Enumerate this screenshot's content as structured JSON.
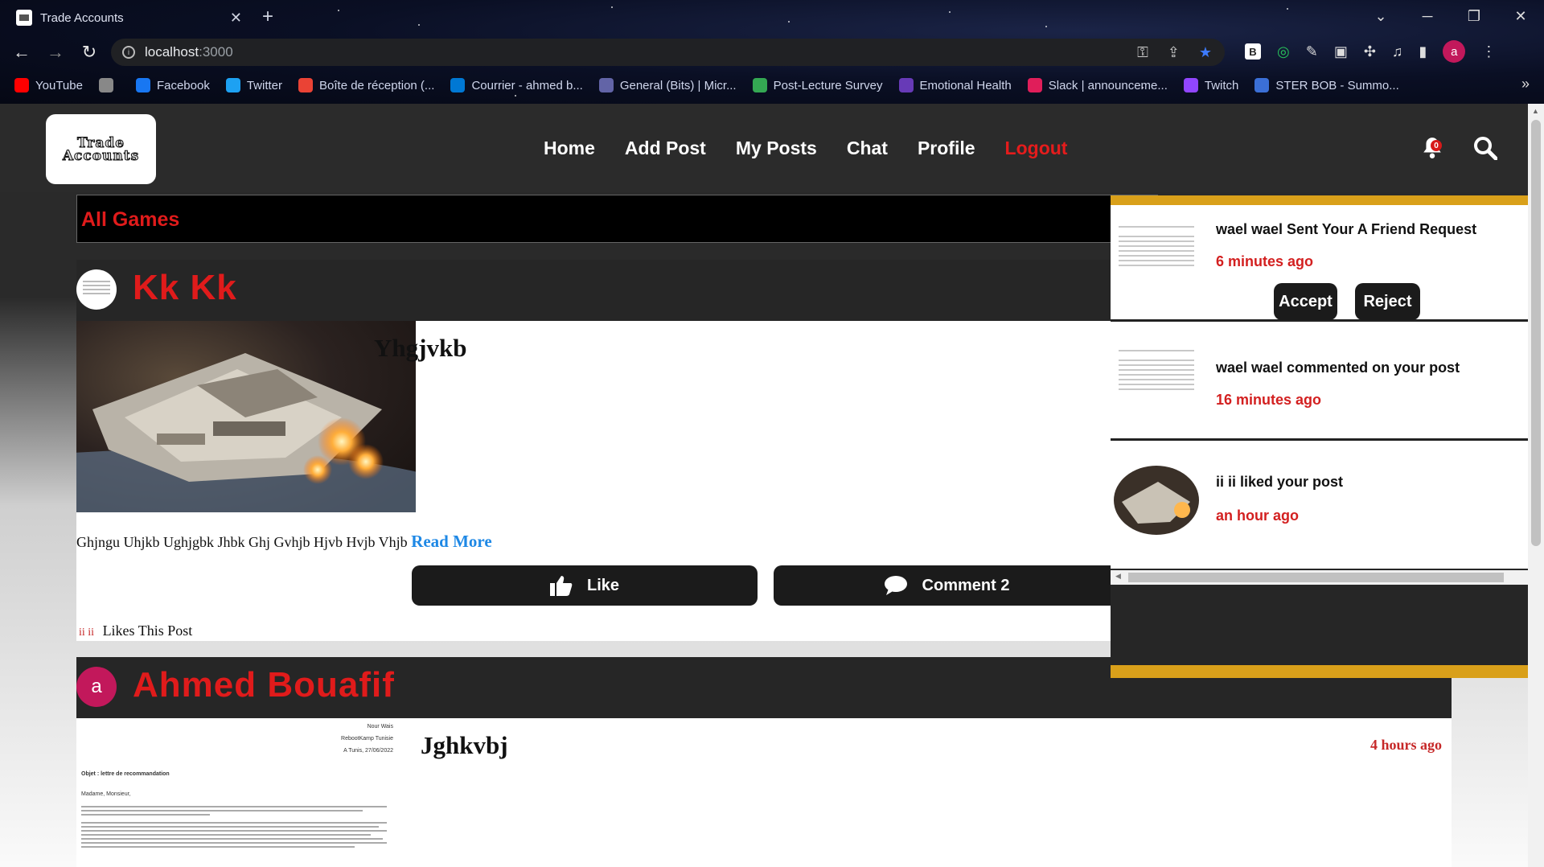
{
  "browser": {
    "tab_title": "Trade Accounts",
    "url_host": "localhost",
    "url_port": ":3000",
    "profile_initial": "a",
    "bookmarks": [
      {
        "label": "YouTube",
        "color": "#ff0000"
      },
      {
        "label": "",
        "color": "#888888"
      },
      {
        "label": "Facebook",
        "color": "#1877f2"
      },
      {
        "label": "Twitter",
        "color": "#1da1f2"
      },
      {
        "label": "Boîte de réception (...",
        "color": "#ea4335"
      },
      {
        "label": "Courrier - ahmed b...",
        "color": "#0078d4"
      },
      {
        "label": "General (Bits) | Micr...",
        "color": "#6264a7"
      },
      {
        "label": "Post-Lecture Survey",
        "color": "#34a853"
      },
      {
        "label": "Emotional Health",
        "color": "#673ab7"
      },
      {
        "label": "Slack | announceme...",
        "color": "#e01e5a"
      },
      {
        "label": "Twitch",
        "color": "#9146ff"
      },
      {
        "label": "STER BOB - Summo...",
        "color": "#3b6fd6"
      }
    ]
  },
  "header": {
    "logo_text": "Trade Accounts",
    "menu": [
      "Home",
      "Add Post",
      "My Posts",
      "Chat",
      "Profile"
    ],
    "logout": "Logout",
    "notification_count": "0"
  },
  "games_bar": {
    "label": "All Games"
  },
  "posts": [
    {
      "author": "Kk Kk",
      "title": "Yhgjvkb",
      "description": "Ghjngu Uhjkb Ughjgbk Jhbk Ghj Gvhjb Hjvb Hvjb Vhjb",
      "read_more": "Read More",
      "like_label": "Like",
      "comment_label": "Comment 2",
      "likes_by": "ii ii",
      "likes_suffix": "Likes This Post"
    },
    {
      "author": "Ahmed Bouafif",
      "author_initial": "a",
      "title": "Jghkvbj",
      "time": "4 hours ago",
      "doc": {
        "r1": "Nour Wais",
        "r2": "RebootKamp Tunisie",
        "r3": "A Tunis, 27/06/2022",
        "objet": "Objet : lettre de recommandation",
        "greeting": "Madame, Monsieur,"
      }
    }
  ],
  "notifications": [
    {
      "text": "wael wael Sent Your A Friend Request",
      "time": "6 minutes ago",
      "accept": "Accept",
      "reject": "Reject"
    },
    {
      "text": "wael wael commented on your post",
      "time": "16 minutes ago"
    },
    {
      "text": "ii ii liked your post",
      "time": "an hour ago"
    }
  ],
  "colors": {
    "accent_red": "#e01b1b",
    "gold": "#d9a01a",
    "link_blue": "#1e88e5"
  }
}
